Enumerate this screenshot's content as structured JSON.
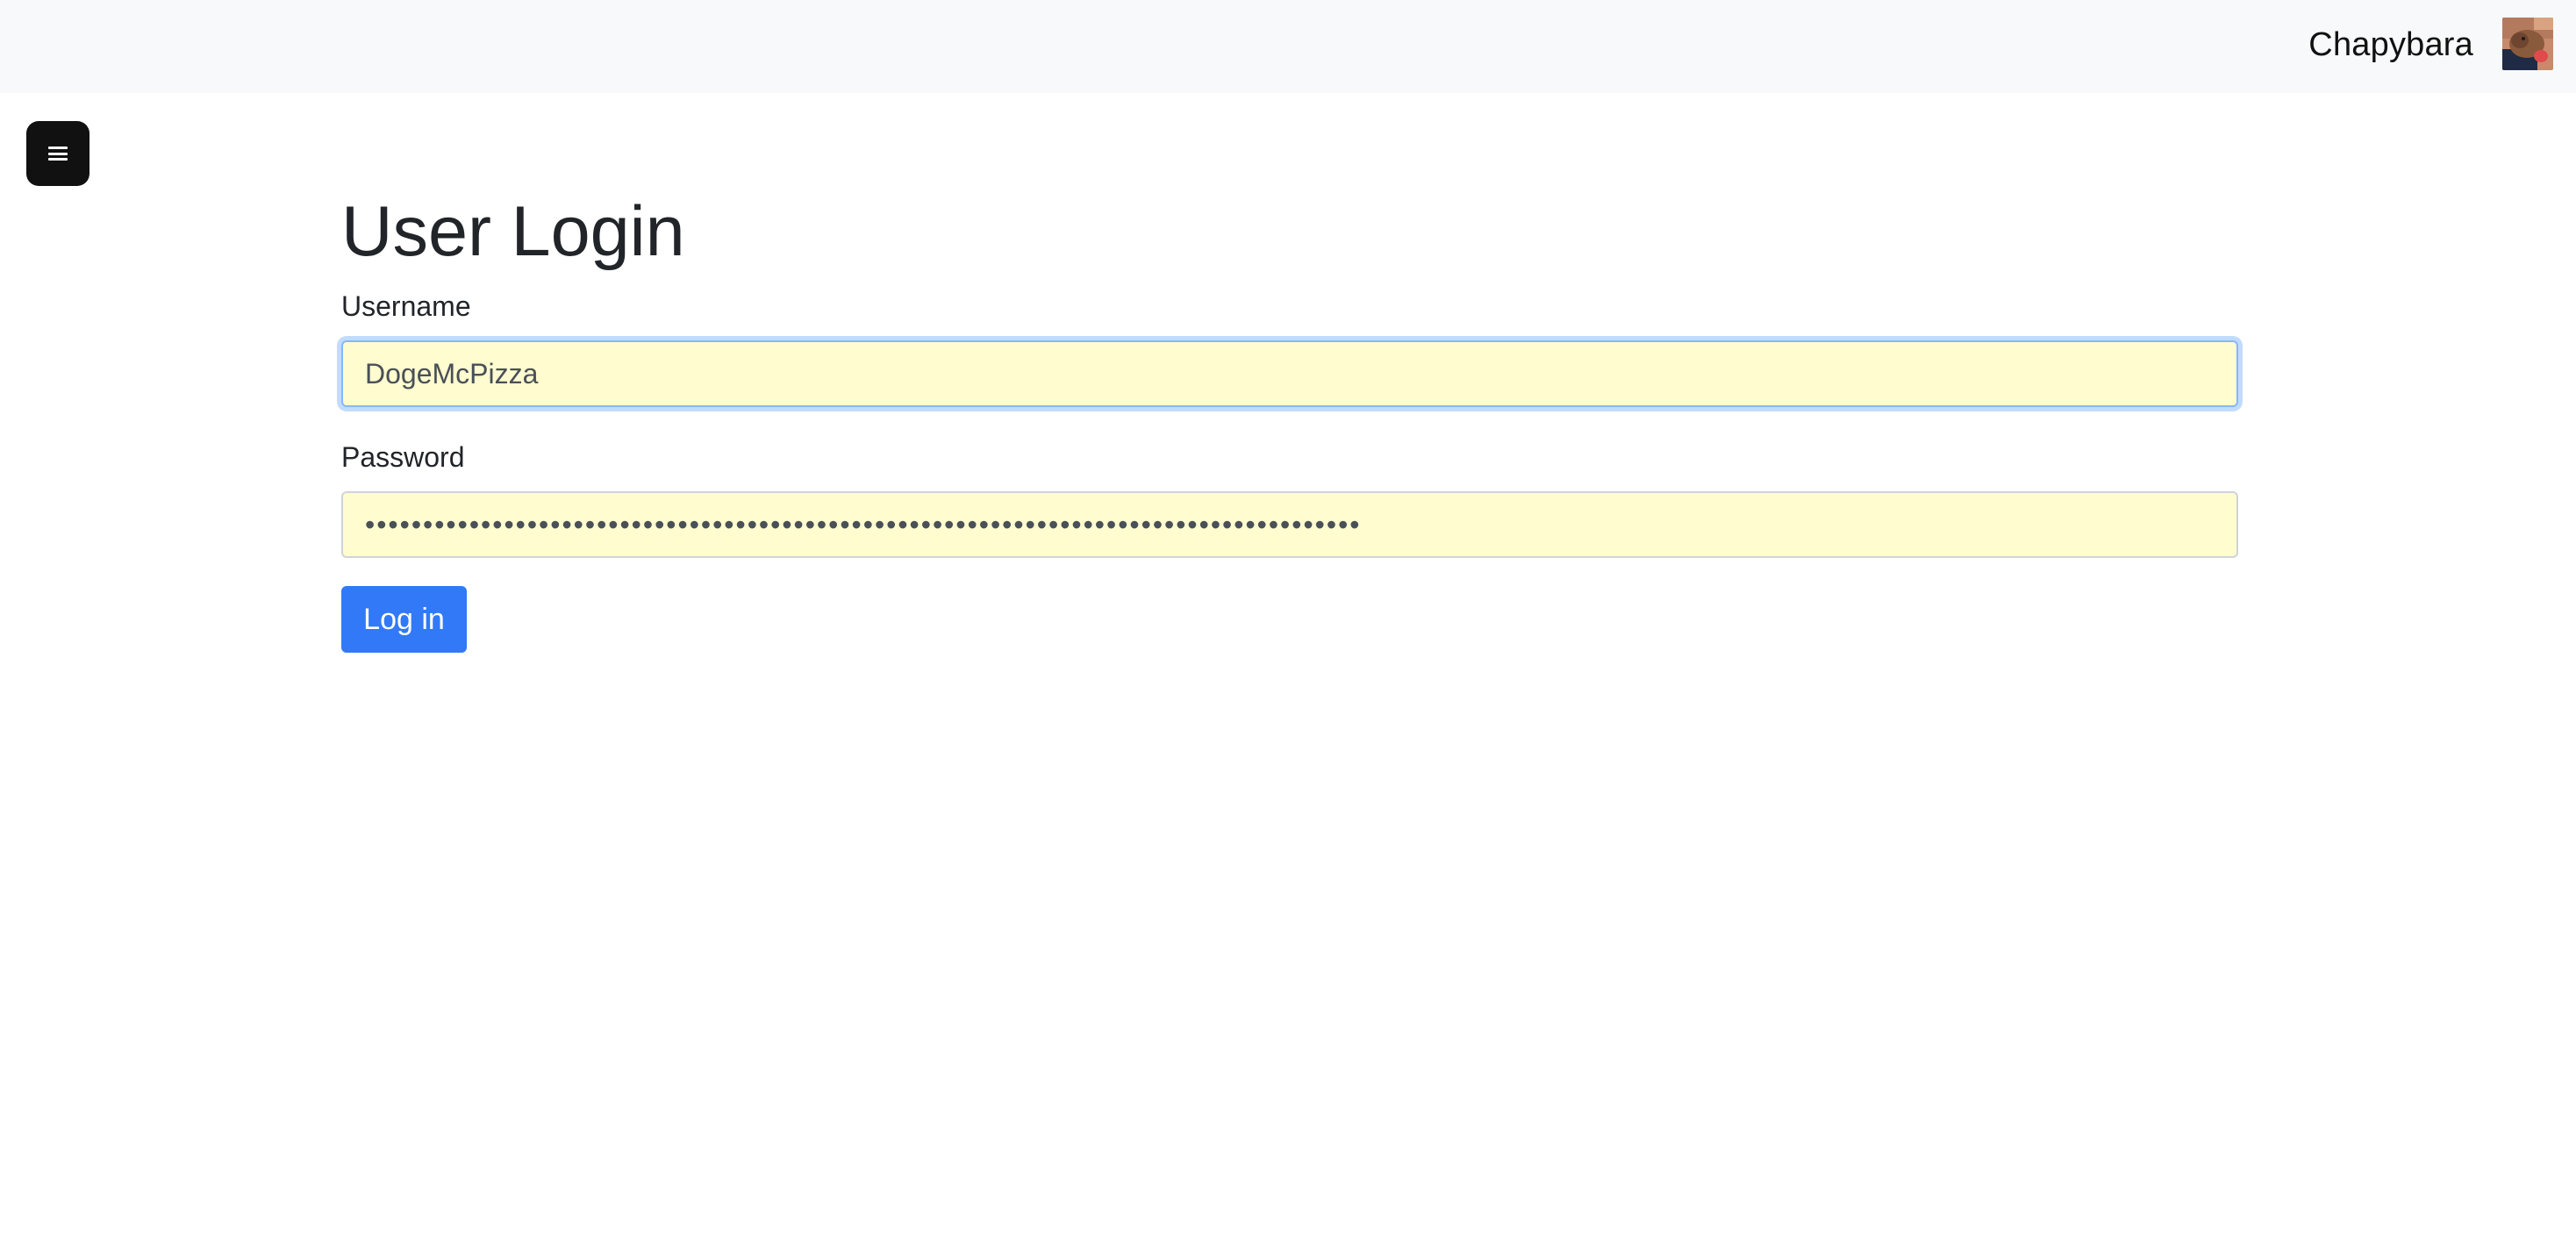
{
  "header": {
    "brand": "Chapybara",
    "avatar_icon": "capybara-avatar-icon",
    "background": "#f8f9fa"
  },
  "menu_button": {
    "icon": "hamburger-menu-icon"
  },
  "login": {
    "title": "User Login",
    "username_label": "Username",
    "username_value": "DogeMcPizza",
    "password_label": "Password",
    "password_value": "••••••••••••••••••••••••••••••••••••••••••••••••••••••••••••••••••••••••••••••••••••••",
    "submit_label": "Log in",
    "autofill_color": "#fffccf",
    "button_color": "#3279f7"
  }
}
